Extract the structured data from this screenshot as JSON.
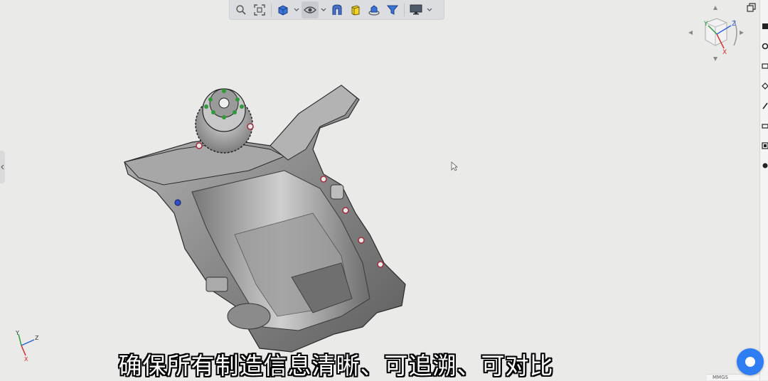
{
  "toolbar": {
    "buttons": [
      {
        "name": "zoom-icon"
      },
      {
        "name": "fit-all-icon"
      },
      {
        "name": "display-style-icon"
      },
      {
        "name": "visibility-eye-icon"
      },
      {
        "name": "section-view-icon"
      },
      {
        "name": "color-appearance-icon"
      },
      {
        "name": "scene-render-icon"
      },
      {
        "name": "filter-icon"
      },
      {
        "name": "monitor-display-icon"
      }
    ]
  },
  "view_cube": {
    "axis_labels": {
      "x": "X",
      "y": "Y",
      "z": "Z"
    }
  },
  "triad": {
    "axis_labels": {
      "x": "X",
      "y": "Y",
      "z": "Z"
    }
  },
  "subtitle": "确保所有制造信息清晰、可追溯、可对比",
  "status_bar": {
    "label": "MMGS"
  },
  "colors": {
    "accent": "#2f7df2",
    "toolbar_bg": "#dcdde0",
    "viewport_bg": "#eaeae9"
  }
}
